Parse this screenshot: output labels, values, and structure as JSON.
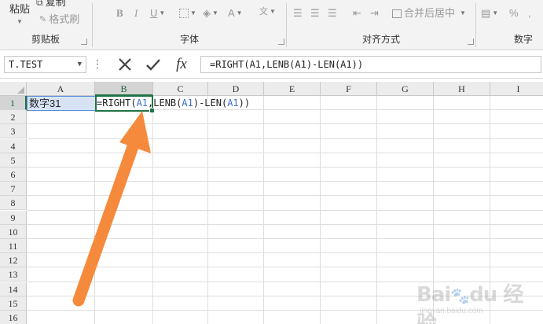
{
  "ribbon": {
    "clipboard": {
      "paste_label": "粘贴",
      "copy_label": "复制",
      "format_painter_label": "格式刷",
      "group_label": "剪贴板"
    },
    "font": {
      "bold": "B",
      "italic": "I",
      "underline": "U",
      "font_color_glyph": "A",
      "group_label": "字体"
    },
    "alignment": {
      "merge_center_label": "合并后居中",
      "group_label": "对齐方式"
    },
    "number": {
      "percent": "%",
      "group_label": "数字"
    }
  },
  "formula_bar": {
    "name_box": "T.TEST",
    "fx_label": "fx",
    "formula": "=RIGHT(A1,LENB(A1)-LEN(A1))"
  },
  "sheet": {
    "columns": [
      "A",
      "B",
      "C",
      "D",
      "E",
      "F",
      "G",
      "H",
      "I"
    ],
    "rows": [
      "1",
      "2",
      "3",
      "4",
      "5",
      "6",
      "7",
      "8",
      "9",
      "10",
      "11",
      "12",
      "13",
      "14",
      "15",
      "16"
    ],
    "selected_column": "B",
    "selected_row": "1",
    "cells": {
      "A1": "数字31",
      "B1_parts": {
        "p1": "=RIGHT(",
        "r1": "A1",
        "p2": ",LENB(",
        "r2": "A1",
        "p3": ")-LEN(",
        "r3": "A1",
        "p4": "))"
      }
    }
  },
  "colors": {
    "accent_green": "#217346",
    "arrow_orange": "#f58a3c",
    "reference_blue": "#3b6fcf"
  }
}
